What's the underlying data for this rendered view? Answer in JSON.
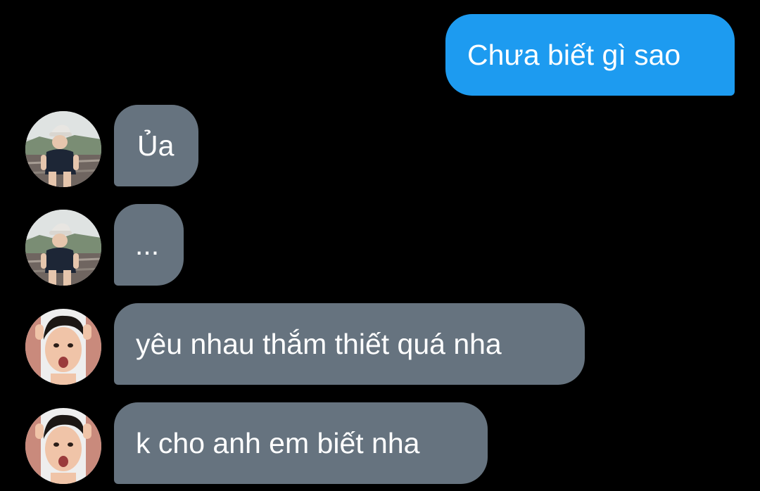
{
  "colors": {
    "background": "#000000",
    "sent_bubble": "#1d9bf0",
    "received_bubble": "#66737f",
    "text": "#ffffff"
  },
  "messages": [
    {
      "direction": "sent",
      "text": "Chưa biết gì sao"
    },
    {
      "direction": "received",
      "avatar": "child-avatar",
      "text": "Ủa"
    },
    {
      "direction": "received",
      "avatar": "child-avatar",
      "text": "..."
    },
    {
      "direction": "received",
      "avatar": "man-avatar",
      "text": "yêu nhau thắm thiết quá nha"
    },
    {
      "direction": "received",
      "avatar": "man-avatar",
      "text": "k cho anh em biết nha"
    }
  ]
}
